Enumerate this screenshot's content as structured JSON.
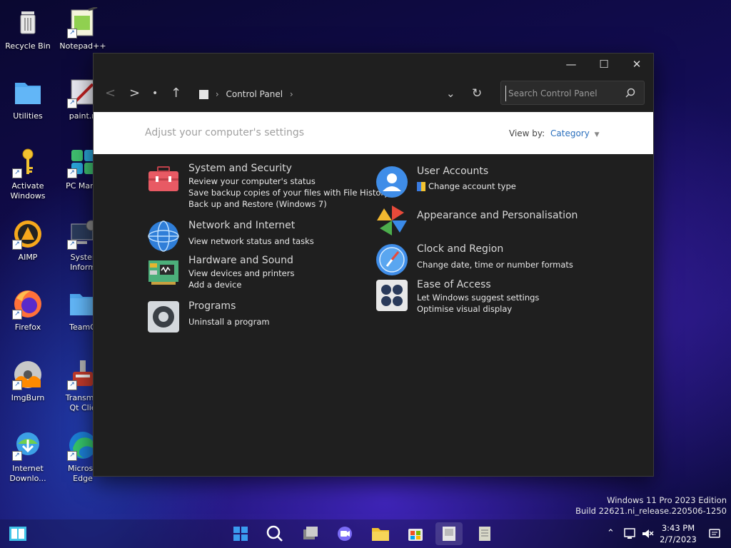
{
  "desktop": {
    "icons": [
      {
        "label": "Recycle Bin"
      },
      {
        "label": "Notepad++"
      },
      {
        "label": "Utilities"
      },
      {
        "label": "paint.n"
      },
      {
        "label": "Activate\nWindows"
      },
      {
        "label": "PC Mana"
      },
      {
        "label": "AIMP"
      },
      {
        "label": "Syster\nInform"
      },
      {
        "label": "Firefox"
      },
      {
        "label": "TeamO"
      },
      {
        "label": "ImgBurn"
      },
      {
        "label": "Transmis\nQt Clie"
      },
      {
        "label": "Internet\nDownlo..."
      },
      {
        "label": "Microso\nEdge"
      }
    ]
  },
  "window": {
    "title_buttons": {
      "minimize": "—",
      "maximize": "☐",
      "close": "✕"
    },
    "nav": {
      "back": "<",
      "forward": ">",
      "dot": "•",
      "up": "↑",
      "dropdown": "⌄",
      "refresh": "↻"
    },
    "breadcrumb": [
      "Control Panel"
    ],
    "search": {
      "placeholder": "Search Control Panel",
      "icon": "search-icon"
    },
    "header": {
      "adjust": "Adjust your computer's settings",
      "view_by_label": "View by:",
      "view_by_value": "Category"
    },
    "left_items": [
      {
        "title": "System and Security",
        "links": [
          "Review your computer's status",
          "Save backup copies of your files with File History",
          "Back up and Restore (Windows 7)"
        ]
      },
      {
        "title": "Network and Internet",
        "links": [
          "View network status and tasks"
        ]
      },
      {
        "title": "Hardware and Sound",
        "links": [
          "View devices and printers",
          "Add a device"
        ]
      },
      {
        "title": "Programs",
        "links": [
          "Uninstall a program"
        ]
      }
    ],
    "right_items": [
      {
        "title": "User Accounts",
        "links": [
          "Change account type"
        ]
      },
      {
        "title": "Appearance and Personalisation",
        "links": []
      },
      {
        "title": "Clock and Region",
        "links": [
          "Change date, time or number formats"
        ]
      },
      {
        "title": "Ease of Access",
        "links": [
          "Let Windows suggest settings",
          "Optimise visual display"
        ]
      }
    ]
  },
  "watermark": {
    "line1": "Windows 11 Pro 2023 Edition",
    "line2": "Build 22621.ni_release.220506-1250"
  },
  "taskbar": {
    "clock_time": "3:43 PM",
    "clock_date": "2/7/2023",
    "accent": "#2a6fbd"
  }
}
